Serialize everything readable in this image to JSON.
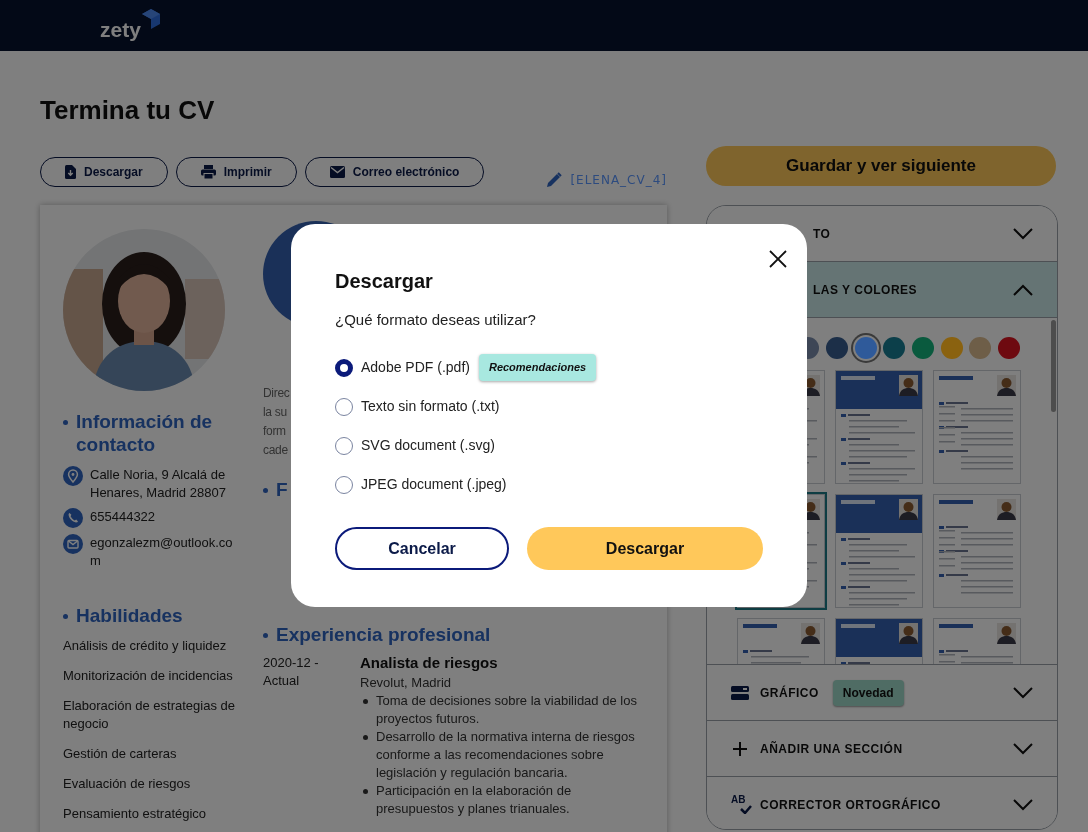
{
  "header": {
    "logo": "zety"
  },
  "page_title": "Termina tu CV",
  "toolbar": [
    {
      "kind": "download",
      "label": "Descargar"
    },
    {
      "kind": "print",
      "label": "Imprimir"
    },
    {
      "kind": "email",
      "label": "Correo electrónico"
    }
  ],
  "file_name": "[ELENA_CV_4]",
  "resume": {
    "contact_heading": "Información de contacto",
    "contact": [
      {
        "kind": "address",
        "text": "Calle Noria, 9 Alcalá de Henares, Madrid 28807"
      },
      {
        "kind": "phone",
        "text": "655444322"
      },
      {
        "kind": "email",
        "text": "egonzalezm@outlook.com"
      }
    ],
    "skills_heading": "Habilidades",
    "skills": [
      "Análisis de crédito y liquidez",
      "Monitorización de incidencias",
      "Elaboración de estrategias de negocio",
      "Gestión de carteras",
      "Evaluación de riesgos",
      "Pensamiento estratégico"
    ],
    "summary_lines": [
      "Direc",
      "la su",
      "form",
      "cade"
    ],
    "education_heading": "F",
    "experience_heading": "Experiencia profesional",
    "experience": [
      {
        "dates": "2020-12 - Actual",
        "title": "Analista de riesgos",
        "company": "Revolut, Madrid",
        "bullets": [
          "Toma de decisiones sobre la viabilidad de los proyectos futuros.",
          "Desarrollo de la normativa interna de riesgos conforme a las recomendaciones sobre legislación y regulación bancaria.",
          "Participación en la elaboración de presupuestos y planes trianuales."
        ]
      }
    ]
  },
  "sidebar": {
    "save_button": "Guardar y ver siguiente",
    "sections": [
      {
        "kind": "covered",
        "label": "TO",
        "expanded": false
      },
      {
        "kind": "covered",
        "label": "LAS Y COLORES",
        "expanded": true
      },
      {
        "kind": "graphic",
        "label": "GRÁFICO",
        "badge": "Novedad",
        "expanded": false
      },
      {
        "kind": "add",
        "label": "AÑADIR UNA SECCIÓN",
        "expanded": false
      },
      {
        "kind": "spellcheck",
        "label": "CORRECTOR ORTOGRÁFICO",
        "icon_text": "AB",
        "expanded": false
      }
    ],
    "colors": [
      {
        "color": "#3d4656",
        "selected": false
      },
      {
        "color": "#1c2f48",
        "selected": false
      },
      {
        "color": "#2f5a9a",
        "selected": true
      },
      {
        "color": "#0c3f4a",
        "selected": false
      },
      {
        "color": "#0a5a3e",
        "selected": false
      },
      {
        "color": "#8a6210",
        "selected": false
      },
      {
        "color": "#6e5e48",
        "selected": false
      },
      {
        "color": "#6e0a10",
        "selected": false
      }
    ],
    "templates": [
      {
        "selected": false
      },
      {
        "selected": false
      },
      {
        "selected": false
      },
      {
        "selected": true
      },
      {
        "selected": false
      },
      {
        "selected": false
      },
      {
        "selected": false
      },
      {
        "selected": false
      },
      {
        "selected": false
      }
    ]
  },
  "dialog": {
    "title": "Descargar",
    "question": "¿Qué formato deseas utilizar?",
    "options": [
      {
        "label": "Adobe PDF (.pdf)",
        "badge": "Recomendaciones",
        "selected": true
      },
      {
        "label": "Texto sin formato (.txt)",
        "selected": false
      },
      {
        "label": "SVG document (.svg)",
        "selected": false
      },
      {
        "label": "JPEG document (.jpeg)",
        "selected": false
      }
    ],
    "cancel": "Cancelar",
    "confirm": "Descargar"
  }
}
